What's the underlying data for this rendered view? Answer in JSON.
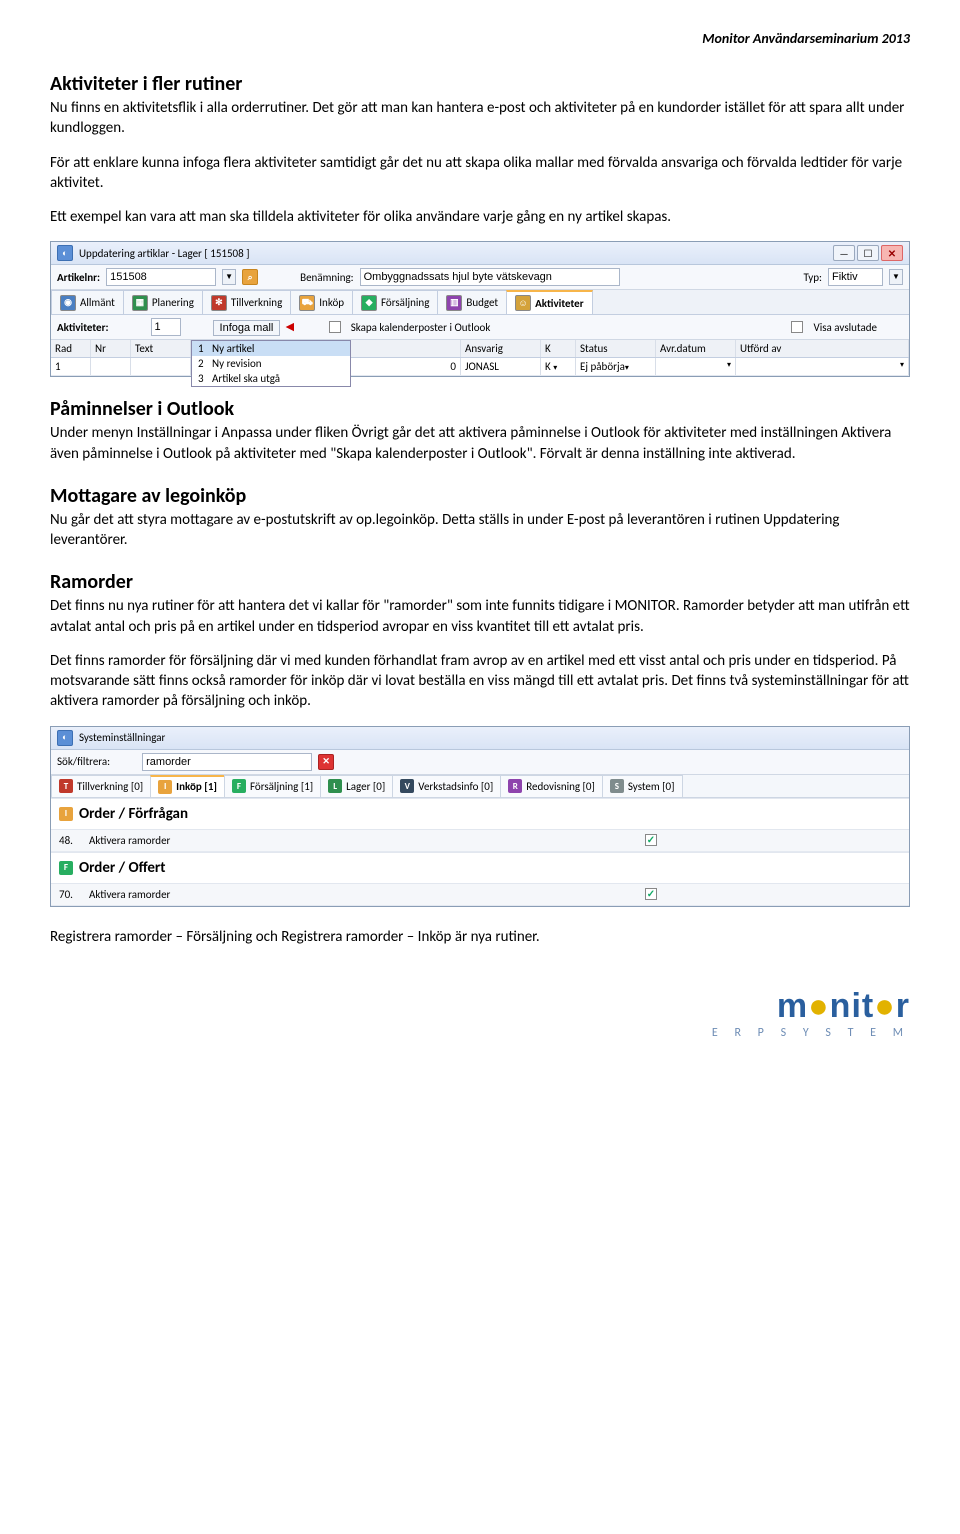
{
  "doc_header": "Monitor Användarseminarium 2013",
  "section1": {
    "title": "Aktiviteter i fler rutiner",
    "p1": "Nu finns en aktivitetsflik i alla orderrutiner. Det gör att man kan hantera e-post och aktiviteter på en kundorder istället för att spara allt under kundloggen.",
    "p2": "För att enklare kunna infoga flera aktiviteter samtidigt går det nu att skapa olika mallar med förvalda ansvariga och förvalda ledtider för varje aktivitet.",
    "p3": "Ett exempel kan vara att man ska tilldela aktiviteter för olika användare varje gång en ny artikel skapas."
  },
  "ss1": {
    "window_title": "Uppdatering artiklar - Lager [ 151508 ]",
    "artikelnr_label": "Artikelnr:",
    "artikelnr_value": "151508",
    "benamning_label": "Benämning:",
    "benamning_value": "Ombyggnadssats hjul byte vätskevagn",
    "typ_label": "Typ:",
    "typ_value": "Fiktiv",
    "tabs": [
      "Allmänt",
      "Planering",
      "Tillverkning",
      "Inköp",
      "Försäljning",
      "Budget",
      "Aktiviteter"
    ],
    "aktiviteter_label": "Aktiviteter:",
    "aktiviteter_value": "1",
    "infoga_btn": "Infoga mall",
    "skapa_label": "Skapa kalenderposter i Outlook",
    "visa_label": "Visa avslutade",
    "columns": [
      "Rad",
      "Nr",
      "Text",
      "",
      "",
      "Ansvarig",
      "K",
      "Status",
      "Avr.datum",
      "Utförd av"
    ],
    "droplist": [
      {
        "n": "1",
        "t": "Ny artikel"
      },
      {
        "n": "2",
        "t": "Ny revision"
      },
      {
        "n": "3",
        "t": "Artikel ska utgå"
      }
    ],
    "row1": {
      "rad": "1",
      "nr": "",
      "e": "0",
      "ansvarig": "JONASL",
      "k": "K",
      "status": "Ej påbörja"
    }
  },
  "section2": {
    "title": "Påminnelser i Outlook",
    "p1": "Under menyn Inställningar i Anpassa under fliken Övrigt går det att aktivera påminnelse i Outlook för aktiviteter med inställningen Aktivera även påminnelse i Outlook på aktiviteter med \"Skapa kalenderposter i Outlook\". Förvalt är denna inställning inte aktiverad."
  },
  "section3": {
    "title": "Mottagare av legoinköp",
    "p1": "Nu går det att styra mottagare av e-postutskrift av op.legoinköp. Detta ställs in under E-post på leverantören i rutinen Uppdatering leverantörer."
  },
  "section4": {
    "title": "Ramorder",
    "p1": "Det finns nu nya rutiner för att hantera det vi kallar för \"ramorder\" som inte funnits tidigare i MONITOR. Ramorder betyder att man utifrån ett avtalat antal och pris på en artikel under en tidsperiod avropar en viss kvantitet till ett avtalat pris.",
    "p2": "Det finns ramorder för försäljning där vi med kunden förhandlat fram avrop av en artikel med ett visst antal och pris under en tidsperiod. På motsvarande sätt finns också ramorder för inköp där vi lovat beställa en viss mängd till ett avtalat pris. Det finns två systeminställningar för att aktivera ramorder på försäljning och inköp."
  },
  "ss2": {
    "window_title": "Systeminställningar",
    "sok_label": "Sök/filtrera:",
    "sok_value": "ramorder",
    "tabs": [
      {
        "icon": "T",
        "color": "#c0392b",
        "label": "Tillverkning [0]"
      },
      {
        "icon": "I",
        "color": "#e8a33d",
        "label": "Inköp [1]",
        "active": true
      },
      {
        "icon": "F",
        "color": "#27ae60",
        "label": "Försäljning [1]"
      },
      {
        "icon": "L",
        "color": "#2f8f4e",
        "label": "Lager [0]"
      },
      {
        "icon": "V",
        "color": "#34495e",
        "label": "Verkstadsinfo [0]"
      },
      {
        "icon": "R",
        "color": "#8e44ad",
        "label": "Redovisning [0]"
      },
      {
        "icon": "S",
        "color": "#7f8c8d",
        "label": "System [0]"
      }
    ],
    "group1_icon_color": "#e8a33d",
    "group1_title": "Order / Förfrågan",
    "row48_num": "48.",
    "row48_label": "Aktivera ramorder",
    "group2_icon_color": "#27ae60",
    "group2_title": "Order / Offert",
    "row70_num": "70.",
    "row70_label": "Aktivera ramorder"
  },
  "final_line": "Registrera ramorder – Försäljning och Registrera ramorder – Inköp är nya rutiner.",
  "logo": {
    "name": "monitor",
    "sub": "E R P   S Y S T E M"
  }
}
